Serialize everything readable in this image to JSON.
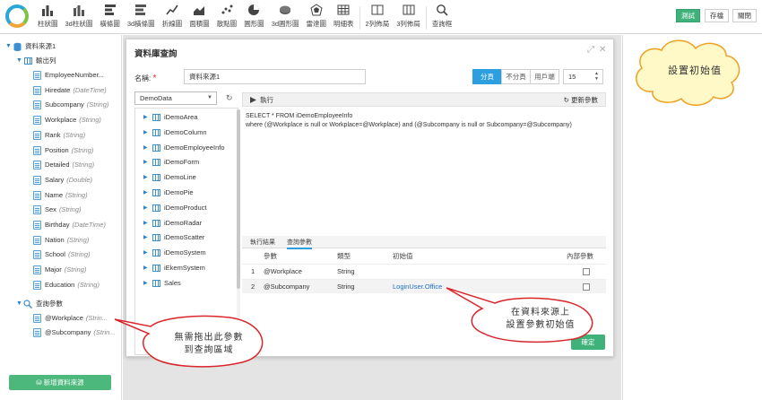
{
  "toolbar": {
    "items": [
      {
        "label": "柱狀圖",
        "icon": "bar-chart-icon"
      },
      {
        "label": "3d柱狀圖",
        "icon": "3d-bar-chart-icon"
      },
      {
        "label": "橫條圖",
        "icon": "horizontal-bar-icon"
      },
      {
        "label": "3d橫條圖",
        "icon": "3d-horizontal-bar-icon"
      },
      {
        "label": "折線圖",
        "icon": "line-chart-icon"
      },
      {
        "label": "面積圖",
        "icon": "area-chart-icon"
      },
      {
        "label": "散點圖",
        "icon": "scatter-chart-icon"
      },
      {
        "label": "圓形圖",
        "icon": "pie-chart-icon"
      },
      {
        "label": "3d圓形圖",
        "icon": "3d-pie-chart-icon"
      },
      {
        "label": "雷達圖",
        "icon": "radar-chart-icon"
      },
      {
        "label": "明細表",
        "icon": "detail-table-icon"
      },
      {
        "label": "2列佈局",
        "icon": "two-column-layout-icon"
      },
      {
        "label": "3列佈局",
        "icon": "three-column-layout-icon"
      },
      {
        "label": "查詢框",
        "icon": "search-icon"
      }
    ],
    "test_label": "測試",
    "save_label": "存檔",
    "close_label": "關閉"
  },
  "sidebar": {
    "root": "資料來源1",
    "output_group": "輸出列",
    "fields": [
      {
        "name": "EmployeeNumber...",
        "type": ""
      },
      {
        "name": "Hiredate",
        "type": "(DateTime)"
      },
      {
        "name": "Subcompany",
        "type": "(String)"
      },
      {
        "name": "Workplace",
        "type": "(String)"
      },
      {
        "name": "Rank",
        "type": "(String)"
      },
      {
        "name": "Position",
        "type": "(String)"
      },
      {
        "name": "Detailed",
        "type": "(String)"
      },
      {
        "name": "Salary",
        "type": "(Double)"
      },
      {
        "name": "Name",
        "type": "(String)"
      },
      {
        "name": "Sex",
        "type": "(String)"
      },
      {
        "name": "Birthday",
        "type": "(DateTime)"
      },
      {
        "name": "Nation",
        "type": "(String)"
      },
      {
        "name": "School",
        "type": "(String)"
      },
      {
        "name": "Major",
        "type": "(String)"
      },
      {
        "name": "Education",
        "type": "(String)"
      }
    ],
    "param_group": "查詢參數",
    "params": [
      {
        "name": "@Workplace",
        "type": "(Strin..."
      },
      {
        "name": "@Subcompany",
        "type": "(Strin..."
      }
    ],
    "new_datasource": "新增資料來源"
  },
  "dialog": {
    "title": "資料庫查詢",
    "name_label": "名稱:",
    "required_mark": "*",
    "name_value": "資料來源1",
    "paging": [
      "分頁",
      "不分頁",
      "用戶端"
    ],
    "page_size": "15",
    "database": "DemoData",
    "tables": [
      "iDemoArea",
      "iDemoColumn",
      "iDemoEmployeeInfo",
      "iDemoForm",
      "iDemoLine",
      "iDemoPie",
      "iDemoProduct",
      "iDemoRadar",
      "iDemoScatter",
      "iDemoSystem",
      "iEkemSystem",
      "Sales"
    ],
    "run_label": "執行",
    "update_params_label": "更新參數",
    "sql_line1": "SELECT * FROM iDemoEmployeeInfo",
    "sql_line2": "where (@Workplace is null or Workplace=@Workplace) and (@Subcompany is null or Subcompany=@Subcompany)",
    "tab_results": "執行結果",
    "tab_params": "查詢參數",
    "col_param": "參數",
    "col_type": "類型",
    "col_initial": "初始值",
    "col_internal": "內部參數",
    "rows": [
      {
        "idx": "1",
        "param": "@Workplace",
        "type": "String",
        "initial": ""
      },
      {
        "idx": "2",
        "param": "@Subcompany",
        "type": "String",
        "initial": "LoginUser.Office"
      }
    ],
    "ok_label": "確定"
  },
  "callouts": {
    "cloud": "設置初始值",
    "datasource_line1": "在資料來源上",
    "datasource_line2": "設置參數初始值",
    "drag_line1": "無需拖出此參數",
    "drag_line2": "到查詢區域"
  },
  "colors": {
    "accent_blue": "#2d9ee0",
    "green": "#3eb27a",
    "callout_border": "#d9252b",
    "cloud_fill": "#fff9c8",
    "cloud_border": "#f0a020"
  }
}
